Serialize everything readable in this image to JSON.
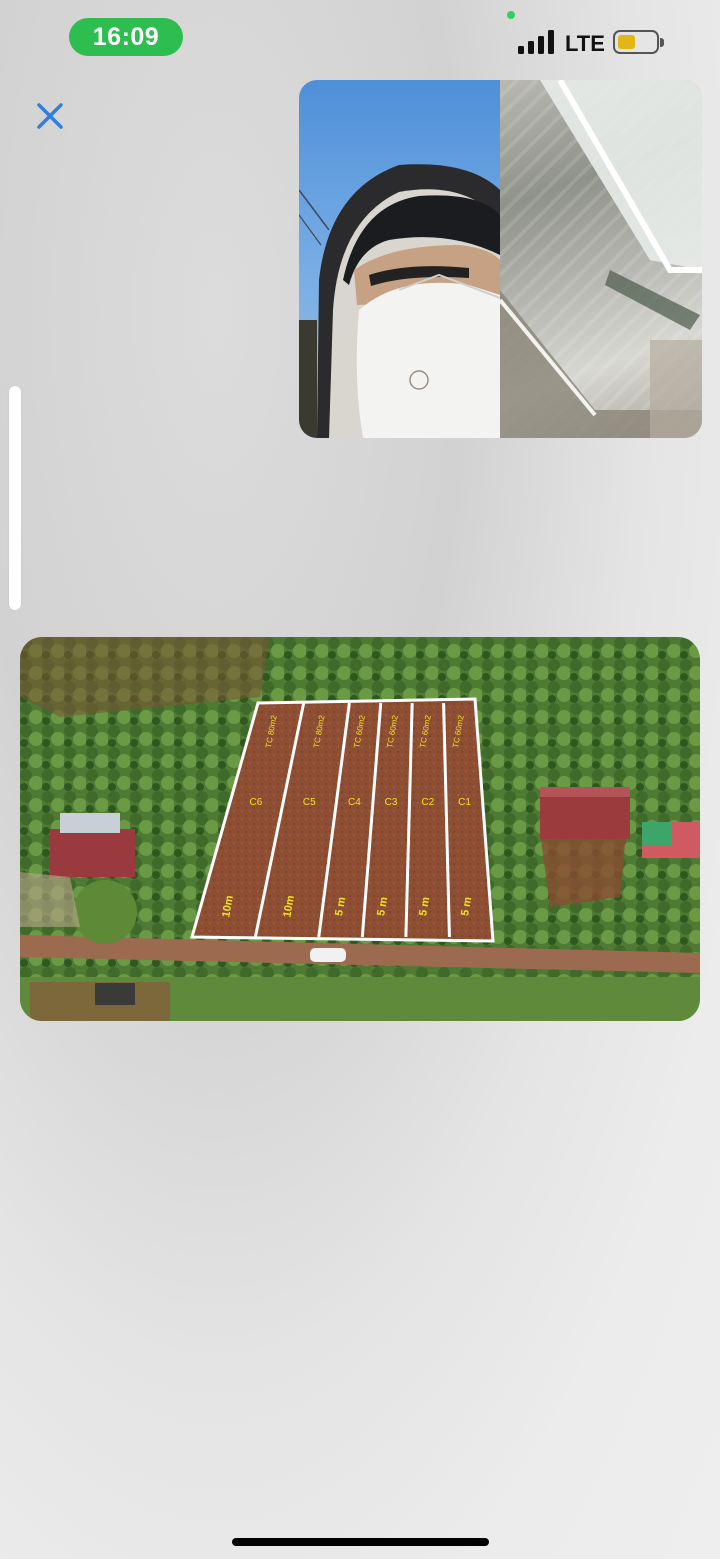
{
  "status_bar": {
    "time": "16:09",
    "network": "LTE",
    "battery_level": 0.45,
    "accent": "#2dbe4f"
  },
  "photo": {
    "lots": [
      {
        "code": "C6",
        "area": "TC 80m2",
        "width": "10m"
      },
      {
        "code": "C5",
        "area": "TC 80m2",
        "width": "10m"
      },
      {
        "code": "C4",
        "area": "TC 60m2",
        "width": "5 m"
      },
      {
        "code": "C3",
        "area": "TC 60m2",
        "width": "5 m"
      },
      {
        "code": "C2",
        "area": "TC 60m2",
        "width": "5 m"
      },
      {
        "code": "C1",
        "area": "TC 60m2",
        "width": "5 m"
      }
    ],
    "label_color": "#f3e21e",
    "outline_color": "#ffffff"
  },
  "icons": {
    "close": "close-icon",
    "signal": "cellular-signal-icon",
    "battery": "battery-icon"
  }
}
